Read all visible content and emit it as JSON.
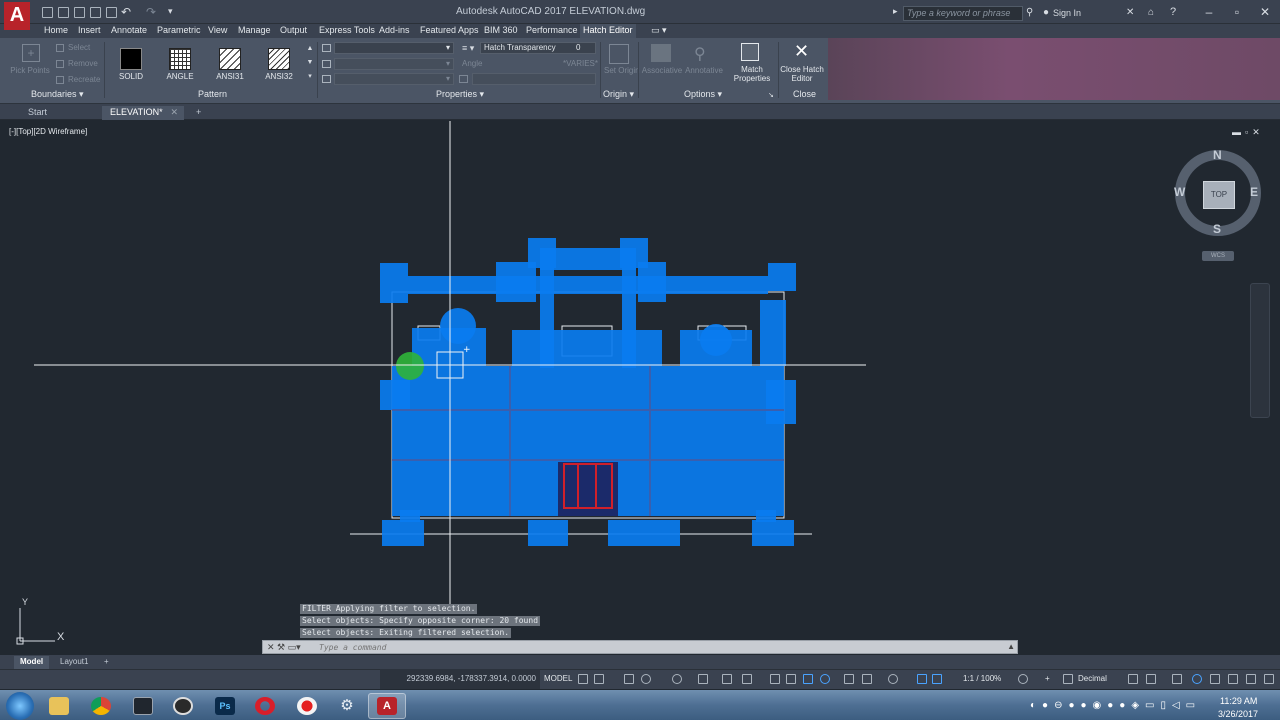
{
  "window": {
    "title": "Autodesk AutoCAD 2017    ELEVATION.dwg",
    "search_placeholder": "Type a keyword or phrase",
    "sign_in": "Sign In",
    "app_letter": "A"
  },
  "ribbon": {
    "tabs": [
      "Home",
      "Insert",
      "Annotate",
      "Parametric",
      "View",
      "Manage",
      "Output",
      "Express Tools",
      "Add-ins",
      "Featured Apps",
      "BIM 360",
      "Performance",
      "Hatch Editor"
    ],
    "active_tab": "Hatch Editor",
    "boundaries": {
      "pick_points": "Pick Points",
      "select": "Select",
      "remove": "Remove",
      "recreate": "Recreate",
      "title": "Boundaries"
    },
    "pattern": {
      "items": [
        "SOLID",
        "ANGLE",
        "ANSI31",
        "ANSI32"
      ],
      "title": "Pattern"
    },
    "properties": {
      "hatch_transparency_label": "Hatch Transparency",
      "hatch_transparency_value": "0",
      "angle_label": "Angle",
      "angle_value": "*VARIES*",
      "title": "Properties"
    },
    "origin": {
      "set_origin": "Set Origin",
      "title": "Origin"
    },
    "options": {
      "associative": "Associative",
      "annotative": "Annotative",
      "match_properties": "Match Properties",
      "title": "Options"
    },
    "close": {
      "close_hatch_editor": "Close Hatch Editor",
      "title": "Close"
    }
  },
  "file_tabs": [
    "Start",
    "ELEVATION*"
  ],
  "viewport": {
    "label": "[-][Top][2D Wireframe]",
    "viewcube": {
      "n": "N",
      "s": "S",
      "e": "E",
      "w": "W",
      "top": "TOP",
      "wcs": "WCS"
    }
  },
  "command_line": {
    "history": [
      "FILTER Applying filter to selection.",
      "Select objects: Specify opposite corner: 20 found",
      "Select objects:  Exiting filtered selection."
    ],
    "placeholder": "Type a command"
  },
  "ucs": {
    "x": "X",
    "y": "Y"
  },
  "layout_tabs": [
    "Model",
    "Layout1"
  ],
  "status_bar": {
    "coords": "292339.6984, -178337.3914, 0.0000",
    "model": "MODEL",
    "scale": "1:1 / 100%",
    "units": "Decimal"
  },
  "taskbar": {
    "time": "11:29 AM",
    "date": "3/26/2017"
  },
  "colors": {
    "hatch_blue": "#0a7cf0",
    "canvas_bg": "#212830",
    "ribbon_bg": "#4b5565",
    "app_red": "#b8232a"
  }
}
